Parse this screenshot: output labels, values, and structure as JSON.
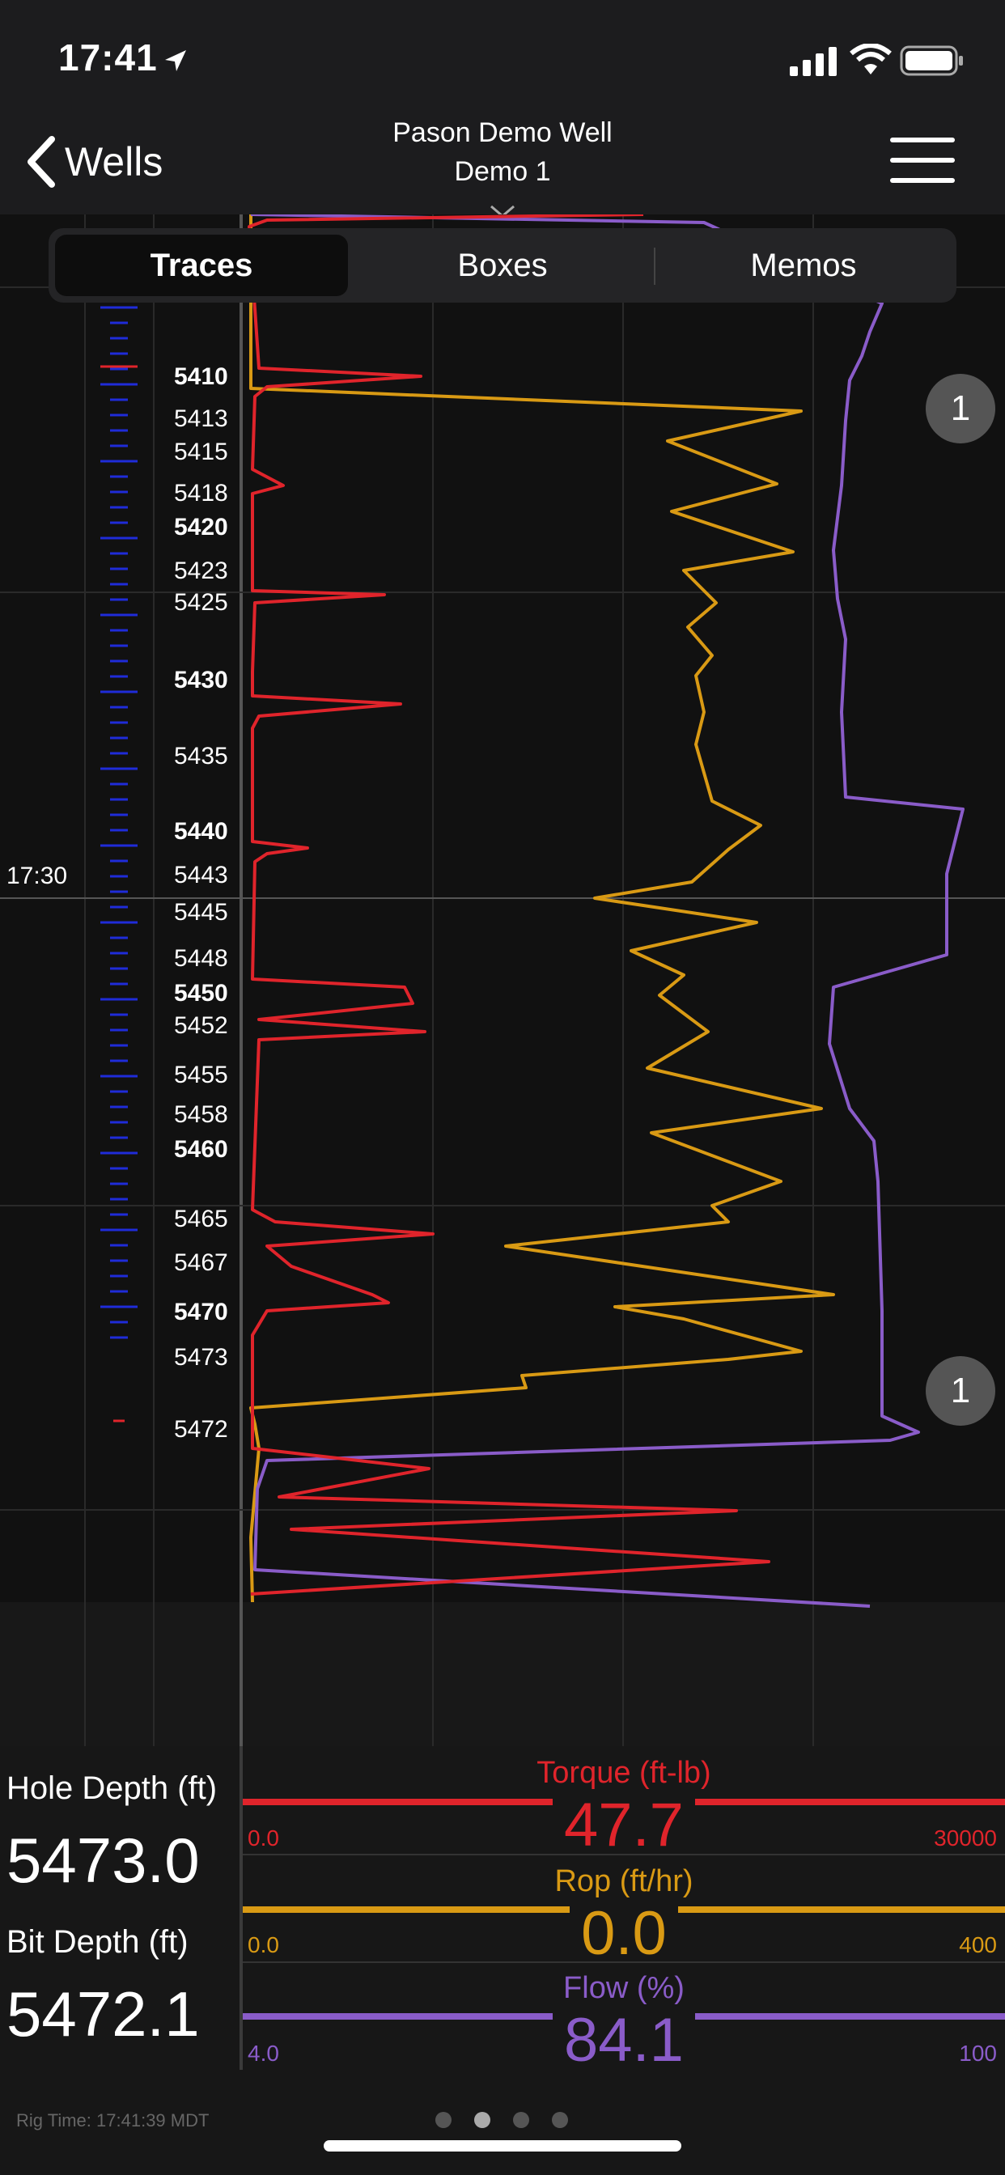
{
  "status_bar": {
    "time": "17:41"
  },
  "nav": {
    "back_label": "Wells",
    "title_line1": "Pason Demo Well",
    "title_line2": "Demo 1"
  },
  "tabs": [
    {
      "label": "Traces",
      "active": true
    },
    {
      "label": "Boxes",
      "active": false
    },
    {
      "label": "Memos",
      "active": false
    }
  ],
  "depth_labels": [
    {
      "text": "5410",
      "bold": true
    },
    {
      "text": "5413",
      "bold": false
    },
    {
      "text": "5415",
      "bold": false
    },
    {
      "text": "5418",
      "bold": false
    },
    {
      "text": "5420",
      "bold": true
    },
    {
      "text": "5423",
      "bold": false
    },
    {
      "text": "5425",
      "bold": false
    },
    {
      "text": "5430",
      "bold": true
    },
    {
      "text": "5435",
      "bold": false
    },
    {
      "text": "5440",
      "bold": true
    },
    {
      "text": "5443",
      "bold": false
    },
    {
      "text": "5445",
      "bold": false
    },
    {
      "text": "5448",
      "bold": false
    },
    {
      "text": "5450",
      "bold": true
    },
    {
      "text": "5452",
      "bold": false
    },
    {
      "text": "5455",
      "bold": false
    },
    {
      "text": "5458",
      "bold": false
    },
    {
      "text": "5460",
      "bold": true
    },
    {
      "text": "5465",
      "bold": false
    },
    {
      "text": "5467",
      "bold": false
    },
    {
      "text": "5470",
      "bold": true
    },
    {
      "text": "5473",
      "bold": false
    },
    {
      "text": "5472",
      "bold": false
    }
  ],
  "time_marker": "17:30",
  "memo_badges": [
    "1",
    "1"
  ],
  "hole_depth": {
    "label": "Hole Depth (ft)",
    "value": "5473.0"
  },
  "bit_depth": {
    "label": "Bit Depth (ft)",
    "value": "5472.1"
  },
  "gauges": [
    {
      "title": "Torque (ft-lb)",
      "value": "47.7",
      "min": "0.0",
      "max": "30000",
      "color": "#e0242b"
    },
    {
      "title": "Rop (ft/hr)",
      "value": "0.0",
      "min": "0.0",
      "max": "400",
      "color": "#d99a14"
    },
    {
      "title": "Flow (%)",
      "value": "84.1",
      "min": "4.0",
      "max": "100",
      "color": "#8a5cc9"
    }
  ],
  "rig_time": "Rig Time:  17:41:39 MDT",
  "page_dots": 4,
  "active_page_dot": 1
}
